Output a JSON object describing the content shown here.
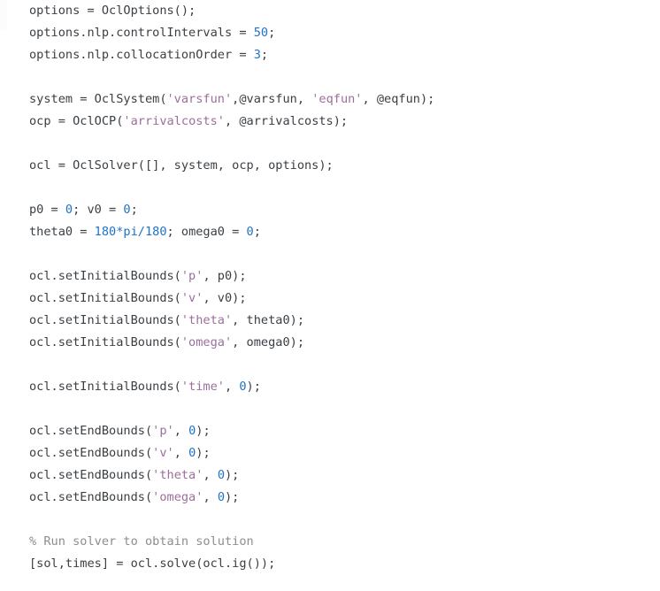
{
  "document": {
    "kind": "code-listing",
    "language": "MATLAB",
    "background_color": "#ffffff",
    "colors": {
      "plain": "#3a3f44",
      "number": "#1f72c8",
      "string": "#9b6f9b",
      "comment": "#8d8d8d"
    }
  },
  "code": {
    "lines": [
      {
        "index": 1,
        "text": "options = OclOptions();",
        "tokens": [
          {
            "t": "options = OclOptions();",
            "c": "plain"
          }
        ]
      },
      {
        "index": 2,
        "text": "options.nlp.controlIntervals = 50;",
        "tokens": [
          {
            "t": "options.nlp.controlIntervals = ",
            "c": "plain"
          },
          {
            "t": "50",
            "c": "number"
          },
          {
            "t": ";",
            "c": "plain"
          }
        ]
      },
      {
        "index": 3,
        "text": "options.nlp.collocationOrder = 3;",
        "tokens": [
          {
            "t": "options.nlp.collocationOrder = ",
            "c": "plain"
          },
          {
            "t": "3",
            "c": "number"
          },
          {
            "t": ";",
            "c": "plain"
          }
        ]
      },
      {
        "index": 4,
        "text": "",
        "tokens": []
      },
      {
        "index": 5,
        "text": "system = OclSystem('varsfun',@varsfun, 'eqfun', @eqfun);",
        "tokens": [
          {
            "t": "system = OclSystem(",
            "c": "plain"
          },
          {
            "t": "'varsfun'",
            "c": "string"
          },
          {
            "t": ",@varsfun, ",
            "c": "plain"
          },
          {
            "t": "'eqfun'",
            "c": "string"
          },
          {
            "t": ", @eqfun);",
            "c": "plain"
          }
        ]
      },
      {
        "index": 6,
        "text": "ocp = OclOCP('arrivalcosts', @arrivalcosts);",
        "tokens": [
          {
            "t": "ocp = OclOCP(",
            "c": "plain"
          },
          {
            "t": "'arrivalcosts'",
            "c": "string"
          },
          {
            "t": ", @arrivalcosts);",
            "c": "plain"
          }
        ]
      },
      {
        "index": 7,
        "text": "",
        "tokens": []
      },
      {
        "index": 8,
        "text": "ocl = OclSolver([], system, ocp, options);",
        "tokens": [
          {
            "t": "ocl = OclSolver([], system, ocp, options);",
            "c": "plain"
          }
        ]
      },
      {
        "index": 9,
        "text": "",
        "tokens": []
      },
      {
        "index": 10,
        "text": "p0 = 0; v0 = 0;",
        "tokens": [
          {
            "t": "p0 = ",
            "c": "plain"
          },
          {
            "t": "0",
            "c": "number"
          },
          {
            "t": "; v0 = ",
            "c": "plain"
          },
          {
            "t": "0",
            "c": "number"
          },
          {
            "t": ";",
            "c": "plain"
          }
        ]
      },
      {
        "index": 11,
        "text": "theta0 = 180*pi/180; omega0 = 0;",
        "tokens": [
          {
            "t": "theta0 = ",
            "c": "plain"
          },
          {
            "t": "180*pi/180",
            "c": "number"
          },
          {
            "t": "; omega0 = ",
            "c": "plain"
          },
          {
            "t": "0",
            "c": "number"
          },
          {
            "t": ";",
            "c": "plain"
          }
        ]
      },
      {
        "index": 12,
        "text": "",
        "tokens": []
      },
      {
        "index": 13,
        "text": "ocl.setInitialBounds('p', p0);",
        "tokens": [
          {
            "t": "ocl.setInitialBounds(",
            "c": "plain"
          },
          {
            "t": "'p'",
            "c": "string"
          },
          {
            "t": ", p0);",
            "c": "plain"
          }
        ]
      },
      {
        "index": 14,
        "text": "ocl.setInitialBounds('v', v0);",
        "tokens": [
          {
            "t": "ocl.setInitialBounds(",
            "c": "plain"
          },
          {
            "t": "'v'",
            "c": "string"
          },
          {
            "t": ", v0);",
            "c": "plain"
          }
        ]
      },
      {
        "index": 15,
        "text": "ocl.setInitialBounds('theta', theta0);",
        "tokens": [
          {
            "t": "ocl.setInitialBounds(",
            "c": "plain"
          },
          {
            "t": "'theta'",
            "c": "string"
          },
          {
            "t": ", theta0);",
            "c": "plain"
          }
        ]
      },
      {
        "index": 16,
        "text": "ocl.setInitialBounds('omega', omega0);",
        "tokens": [
          {
            "t": "ocl.setInitialBounds(",
            "c": "plain"
          },
          {
            "t": "'omega'",
            "c": "string"
          },
          {
            "t": ", omega0);",
            "c": "plain"
          }
        ]
      },
      {
        "index": 17,
        "text": "",
        "tokens": []
      },
      {
        "index": 18,
        "text": "ocl.setInitialBounds('time', 0);",
        "tokens": [
          {
            "t": "ocl.setInitialBounds(",
            "c": "plain"
          },
          {
            "t": "'time'",
            "c": "string"
          },
          {
            "t": ", ",
            "c": "plain"
          },
          {
            "t": "0",
            "c": "number"
          },
          {
            "t": ");",
            "c": "plain"
          }
        ]
      },
      {
        "index": 19,
        "text": "",
        "tokens": []
      },
      {
        "index": 20,
        "text": "ocl.setEndBounds('p', 0);",
        "tokens": [
          {
            "t": "ocl.setEndBounds(",
            "c": "plain"
          },
          {
            "t": "'p'",
            "c": "string"
          },
          {
            "t": ", ",
            "c": "plain"
          },
          {
            "t": "0",
            "c": "number"
          },
          {
            "t": ");",
            "c": "plain"
          }
        ]
      },
      {
        "index": 21,
        "text": "ocl.setEndBounds('v', 0);",
        "tokens": [
          {
            "t": "ocl.setEndBounds(",
            "c": "plain"
          },
          {
            "t": "'v'",
            "c": "string"
          },
          {
            "t": ", ",
            "c": "plain"
          },
          {
            "t": "0",
            "c": "number"
          },
          {
            "t": ");",
            "c": "plain"
          }
        ]
      },
      {
        "index": 22,
        "text": "ocl.setEndBounds('theta', 0);",
        "tokens": [
          {
            "t": "ocl.setEndBounds(",
            "c": "plain"
          },
          {
            "t": "'theta'",
            "c": "string"
          },
          {
            "t": ", ",
            "c": "plain"
          },
          {
            "t": "0",
            "c": "number"
          },
          {
            "t": ");",
            "c": "plain"
          }
        ]
      },
      {
        "index": 23,
        "text": "ocl.setEndBounds('omega', 0);",
        "tokens": [
          {
            "t": "ocl.setEndBounds(",
            "c": "plain"
          },
          {
            "t": "'omega'",
            "c": "string"
          },
          {
            "t": ", ",
            "c": "plain"
          },
          {
            "t": "0",
            "c": "number"
          },
          {
            "t": ");",
            "c": "plain"
          }
        ]
      },
      {
        "index": 24,
        "text": "",
        "tokens": []
      },
      {
        "index": 25,
        "text": "% Run solver to obtain solution",
        "tokens": [
          {
            "t": "% Run solver to obtain solution",
            "c": "comment"
          }
        ]
      },
      {
        "index": 26,
        "text": "[sol,times] = ocl.solve(ocl.ig());",
        "tokens": [
          {
            "t": "[sol,times] = ocl.solve(ocl.ig());",
            "c": "plain"
          }
        ]
      }
    ]
  }
}
